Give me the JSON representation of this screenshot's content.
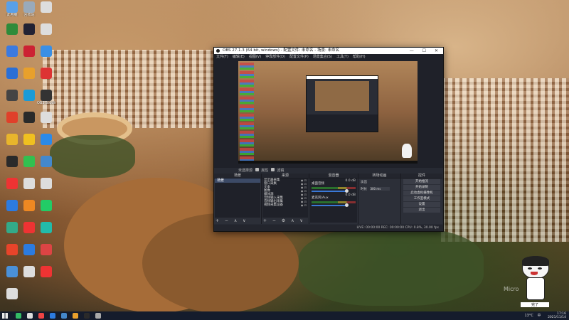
{
  "desktop": {
    "watermark": "Micro",
    "icons": [
      {
        "label": "此电脑",
        "color": "#5aa0e8"
      },
      {
        "label": "回收站",
        "color": "#9ab"
      },
      {
        "label": "",
        "color": "#ddd"
      },
      {
        "label": "",
        "color": "#2e8b3a"
      },
      {
        "label": "",
        "color": "#223"
      },
      {
        "label": "",
        "color": "#ddd"
      },
      {
        "label": "",
        "color": "#3c7ae0"
      },
      {
        "label": "",
        "color": "#c23"
      },
      {
        "label": "",
        "color": "#3a8fe5"
      },
      {
        "label": "",
        "color": "#2a6fd6"
      },
      {
        "label": "",
        "color": "#e8a02c"
      },
      {
        "label": "",
        "color": "#d33"
      },
      {
        "label": "",
        "color": "#444"
      },
      {
        "label": "",
        "color": "#1a9bd7"
      },
      {
        "label": "OBS Studio",
        "color": "#333"
      },
      {
        "label": "",
        "color": "#e0402a"
      },
      {
        "label": "",
        "color": "#2a2a2a"
      },
      {
        "label": "",
        "color": "#ddd"
      },
      {
        "label": "",
        "color": "#e8b52c"
      },
      {
        "label": "",
        "color": "#f0c020"
      },
      {
        "label": "",
        "color": "#2c8ae8"
      },
      {
        "label": "",
        "color": "#2a2a2a"
      },
      {
        "label": "",
        "color": "#32c050"
      },
      {
        "label": "",
        "color": "#48c"
      },
      {
        "label": "",
        "color": "#e33"
      },
      {
        "label": "",
        "color": "#ddd"
      },
      {
        "label": "",
        "color": "#ddd"
      },
      {
        "label": "",
        "color": "#2c7be0"
      },
      {
        "label": "",
        "color": "#e82"
      },
      {
        "label": "",
        "color": "#2c6"
      },
      {
        "label": "",
        "color": "#3a8"
      },
      {
        "label": "",
        "color": "#e33"
      },
      {
        "label": "",
        "color": "#2ba"
      },
      {
        "label": "",
        "color": "#e8442a"
      },
      {
        "label": "",
        "color": "#2c7be0"
      },
      {
        "label": "",
        "color": "#d44"
      },
      {
        "label": "",
        "color": "#4a90d8"
      },
      {
        "label": "",
        "color": "#ddd"
      },
      {
        "label": "",
        "color": "#e33"
      },
      {
        "label": "",
        "color": "#ddd"
      }
    ]
  },
  "obs": {
    "title": "OBS 27.1.3 (64 bit, windows) - 配置文件: 未命名 - 场景: 未命名",
    "window_controls": "— ☐ ✕",
    "menu": [
      "文件(F)",
      "编辑(E)",
      "视图(V)",
      "停靠部件(D)",
      "配置文件(P)",
      "场景集合(S)",
      "工具(T)",
      "帮助(H)"
    ],
    "preview_status": [
      "未选择源",
      "属性",
      "滤镜"
    ],
    "docks": {
      "scenes": {
        "title": "场景",
        "items": [
          "场景"
        ],
        "footer": "+ − ∧ ∨"
      },
      "sources": {
        "title": "来源",
        "items": [
          "显示器采集",
          "窗口采集",
          "文本",
          "图像",
          "媒体源",
          "音频输入采集",
          "音频输出采集",
          "视频采集设备"
        ],
        "footer": "+ − ⚙ ∧ ∨"
      },
      "mixer": {
        "title": "混音器",
        "channels": [
          {
            "name": "桌面音频",
            "db": "0.0 dB"
          },
          {
            "name": "麦克风/Aux",
            "db": "0.0 dB"
          }
        ]
      },
      "transitions": {
        "title": "转场动画",
        "type_label": "淡出",
        "duration_label": "时长",
        "duration_value": "300 ms"
      },
      "controls": {
        "title": "控件",
        "buttons": [
          "开始推流",
          "开始录制",
          "启动虚拟摄像机",
          "工作室模式",
          "设置",
          "退出"
        ]
      }
    },
    "status_bar": "LIVE: 00:00:00   REC: 00:00:00   CPU: 0.8%, 30.00 fps"
  },
  "mascot": {
    "caption": "完了"
  },
  "taskbar": {
    "icons": [
      "#3b6",
      "#ddd",
      "#e44",
      "#2c7be0",
      "#48c",
      "#e8a02c",
      "#2a2a2a",
      "#aaa"
    ],
    "weather": "13°C",
    "lang": "中",
    "time": "17:16",
    "date": "2021/11/14"
  }
}
